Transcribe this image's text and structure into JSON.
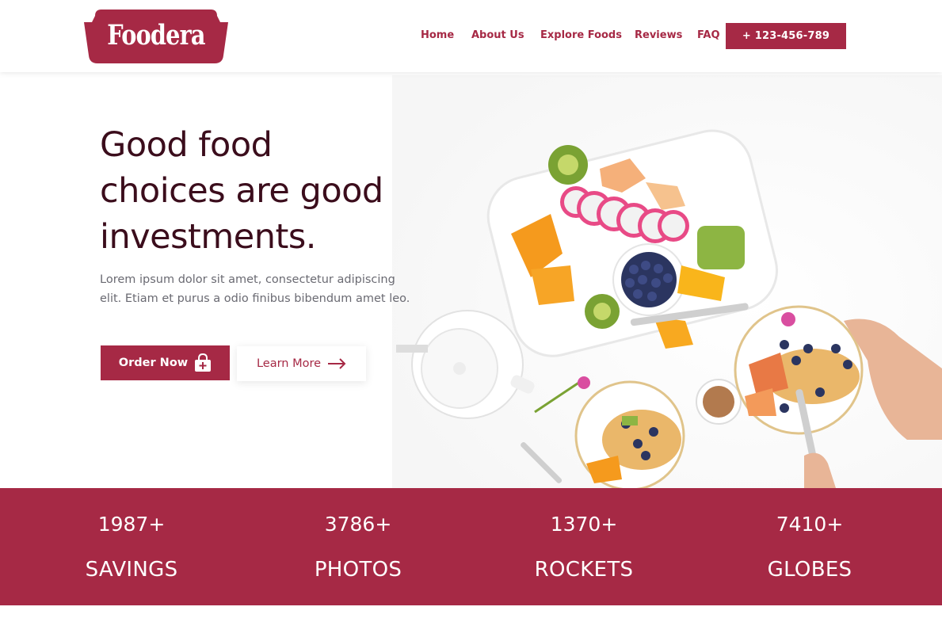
{
  "brand": {
    "name": "Foodera",
    "color": "#a62945",
    "dark_text": "#3b0d1c"
  },
  "nav": {
    "items": [
      {
        "label": "Home"
      },
      {
        "label": "About Us"
      },
      {
        "label": "Explore Foods"
      },
      {
        "label": "Reviews"
      },
      {
        "label": "FAQ"
      }
    ],
    "phone_label": "+ 123-456-789"
  },
  "hero": {
    "headline_line1": "Good food",
    "headline_line2": "choices are good",
    "headline_line3": "investments.",
    "lede_line1": "Lorem ipsum dolor sit amet, consectetur adipiscing",
    "lede_line2": "elit. Etiam et purus a odio finibus bibendum amet leo.",
    "order_label": "Order Now",
    "order_icon": "shopping-bag-plus-icon",
    "learn_label": "Learn More",
    "learn_icon": "arrow-right-icon",
    "image": "breakfast-table-fruit-platter-photo"
  },
  "stats": [
    {
      "value": "1987+",
      "label": "SAVINGS"
    },
    {
      "value": "3786+",
      "label": "PHOTOS"
    },
    {
      "value": "1370+",
      "label": "ROCKETS"
    },
    {
      "value": "7410+",
      "label": "GLOBES"
    }
  ]
}
